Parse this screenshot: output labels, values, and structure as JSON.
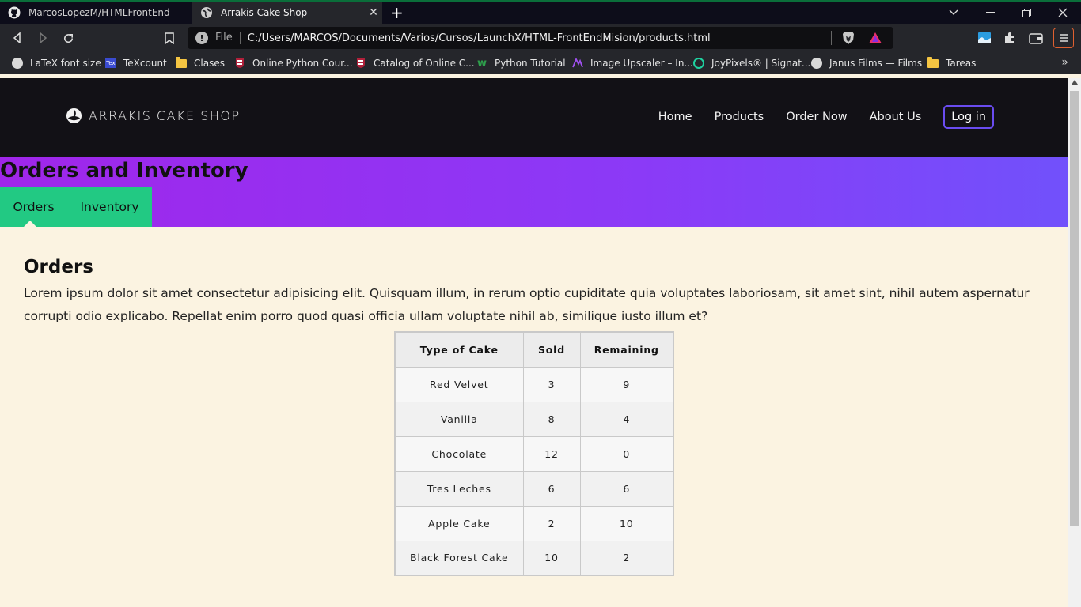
{
  "browser": {
    "tabs": [
      {
        "title": "MarcosLopezM/HTMLFrontEnd",
        "icon": "github-icon"
      },
      {
        "title": "Arrakis Cake Shop",
        "icon": "globe-icon"
      }
    ],
    "address": {
      "scheme_label": "File",
      "url": "C:/Users/MARCOS/Documents/Varios/Cursos/LaunchX/HTML-FrontEndMision/products.html"
    },
    "bookmarks": [
      {
        "label": "LaTeX font size",
        "icon": "globe-icon"
      },
      {
        "label": "TeXcount",
        "icon": "texcount-icon"
      },
      {
        "label": "Clases",
        "icon": "folder-icon"
      },
      {
        "label": "Online Python Cour...",
        "icon": "harvard-icon"
      },
      {
        "label": "Catalog of Online C...",
        "icon": "harvard-icon"
      },
      {
        "label": "Python Tutorial",
        "icon": "w3-icon"
      },
      {
        "label": "Image Upscaler – In...",
        "icon": "upscaler-icon"
      },
      {
        "label": "JoyPixels® | Signat...",
        "icon": "joypixels-icon"
      },
      {
        "label": "Janus Films — Films",
        "icon": "globe-icon"
      },
      {
        "label": "Tareas",
        "icon": "folder-icon"
      }
    ],
    "more_label": "»"
  },
  "site": {
    "logo_text": "ARRAKIS CAKE SHOP",
    "nav": [
      "Home",
      "Products",
      "Order Now",
      "About Us"
    ],
    "login_label": "Log in"
  },
  "banner": {
    "title": "Orders and Inventory",
    "tabs": [
      "Orders",
      "Inventory"
    ]
  },
  "section": {
    "heading": "Orders",
    "paragraph": "Lorem ipsum dolor sit amet consectetur adipisicing elit. Quisquam illum, in rerum optio cupiditate quia voluptates laboriosam, sit amet sint, nihil autem aspernatur corrupti odio explicabo. Repellat enim porro quod quasi officia ullam voluptate nihil ab, similique iusto illum et?"
  },
  "table": {
    "headers": [
      "Type of Cake",
      "Sold",
      "Remaining"
    ],
    "rows": [
      [
        "Red Velvet",
        "3",
        "9"
      ],
      [
        "Vanilla",
        "8",
        "4"
      ],
      [
        "Chocolate",
        "12",
        "0"
      ],
      [
        "Tres Leches",
        "6",
        "6"
      ],
      [
        "Apple Cake",
        "2",
        "10"
      ],
      [
        "Black Forest Cake",
        "10",
        "2"
      ]
    ]
  },
  "colors": {
    "banner_start": "#a026ea",
    "banner_end": "#7151fb",
    "tab_green": "#22c983",
    "page_bg": "#fbf3e1",
    "header_bg": "#121116"
  }
}
